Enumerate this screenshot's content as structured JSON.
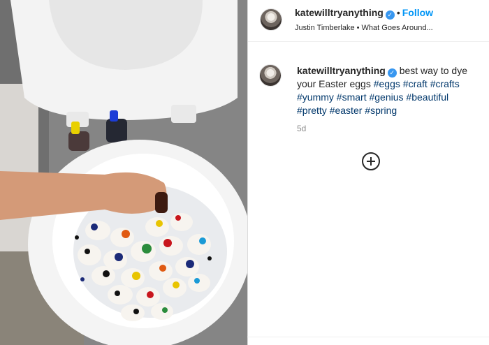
{
  "post": {
    "username": "katewilltryanything",
    "follow_label": "Follow",
    "separator": "•",
    "audio": "Justin Timberlake • What Goes Around...",
    "caption_text": "best way to dye your Easter eggs",
    "hashtags": [
      "#eggs",
      "#craft",
      "#crafts",
      "#yummy",
      "#smart",
      "#genius",
      "#beautiful",
      "#pretty",
      "#easter",
      "#spring"
    ],
    "time_ago": "5d",
    "verified_symbol": "✓"
  },
  "colors": {
    "follow_blue": "#0095f6",
    "verified_blue": "#3897f0",
    "hashtag_blue": "#00376b",
    "muted_gray": "#8e8e8e"
  },
  "icons": {
    "verified": "verified-badge-icon",
    "load_more": "plus-circle-icon"
  }
}
